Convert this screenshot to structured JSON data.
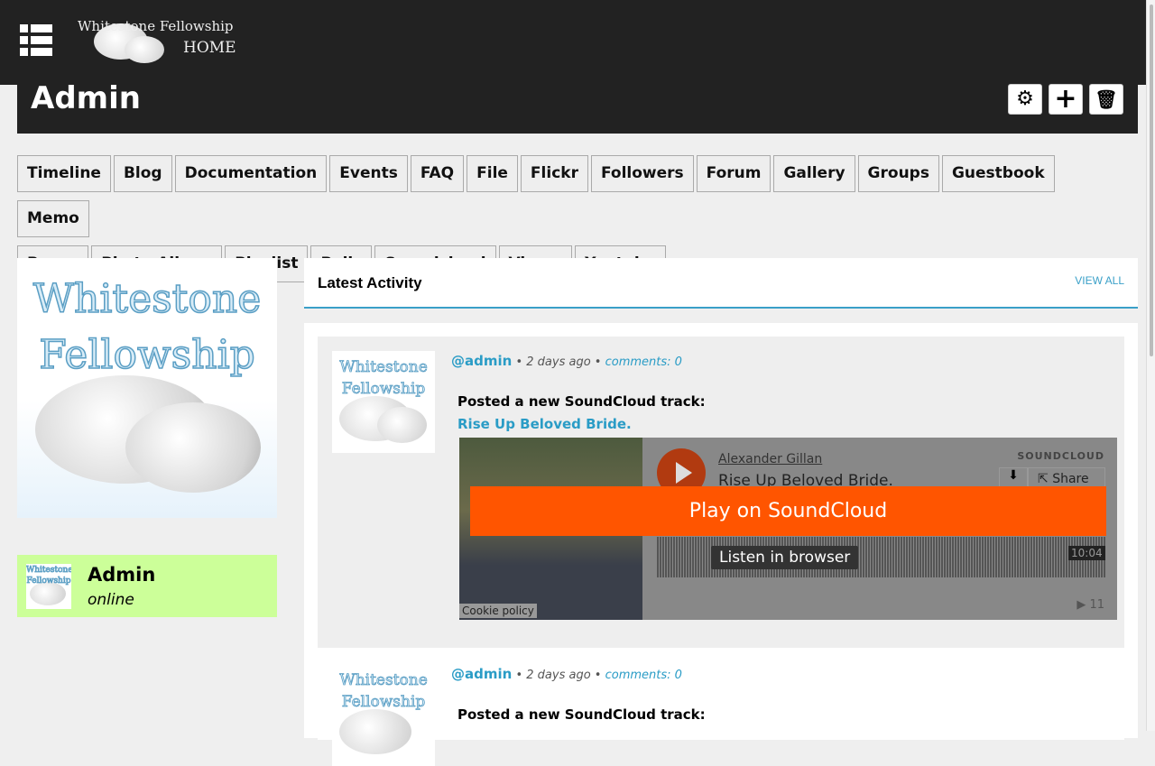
{
  "header": {
    "logo_text": "Whitestone Fellowship",
    "home_label": "HOME"
  },
  "page_title": "Admin",
  "actions": {
    "settings": "gear-icon",
    "add": "plus-icon",
    "delete": "trash-icon"
  },
  "tabs": [
    "Timeline",
    "Blog",
    "Documentation",
    "Events",
    "FAQ",
    "File",
    "Flickr",
    "Followers",
    "Forum",
    "Gallery",
    "Groups",
    "Guestbook",
    "Memo",
    "Pages",
    "Photo Album",
    "Playlist",
    "Polls",
    "Soundcloud",
    "Vimeo",
    "Youtube"
  ],
  "sidebar": {
    "image_text_1": "Whitestone",
    "image_text_2": "Fellowship",
    "user_name": "Admin",
    "user_status": "online"
  },
  "activity": {
    "title": "Latest Activity",
    "view_all": "VIEW ALL",
    "items": [
      {
        "user": "@admin",
        "time": "• 2 days ago •",
        "comments": "comments: 0",
        "action": "Posted a new SoundCloud track:",
        "track": "Rise Up Beloved Bride.",
        "player": {
          "artist": "Alexander Gillan",
          "title": "Rise Up Beloved Bride.",
          "brand": "SOUNDCLOUD",
          "share": "Share",
          "play_label": "Play on SoundCloud",
          "listen_label": "Listen in browser",
          "duration": "10:04",
          "plays": "11",
          "cookie": "Cookie policy"
        }
      },
      {
        "user": "@admin",
        "time": "• 2 days ago •",
        "comments": "comments: 0",
        "action": "Posted a new SoundCloud track:"
      }
    ]
  }
}
